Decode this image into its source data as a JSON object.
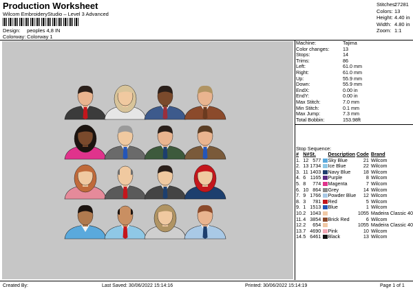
{
  "header": {
    "title": "Production Worksheet",
    "subtitle": "Wilcom EmbroideryStudio – Level 3 Advanced",
    "design_label": "Design:",
    "design_value": "peoples 4,8 IN",
    "colorway_label": "Colorway:",
    "colorway_value": "Colorway 1"
  },
  "summary": [
    {
      "label": "Stitches:",
      "value": "27281"
    },
    {
      "label": "Colors:",
      "value": "13"
    },
    {
      "label": "Height:",
      "value": "4.40 in"
    },
    {
      "label": "Width:",
      "value": "4.80 in"
    },
    {
      "label": "Zoom:",
      "value": "1:1"
    }
  ],
  "properties": [
    {
      "label": "Machine:",
      "value": "Tajima"
    },
    {
      "label": "Color changes:",
      "value": "13"
    },
    {
      "label": "Stops:",
      "value": "14"
    },
    {
      "label": "Trims:",
      "value": "86"
    },
    {
      "label": "Left:",
      "value": "61.0 mm"
    },
    {
      "label": "Right:",
      "value": "61.0 mm"
    },
    {
      "label": "Up:",
      "value": "55.9 mm"
    },
    {
      "label": "Down:",
      "value": "55.9 mm"
    },
    {
      "label": "EndX:",
      "value": "0.00 in"
    },
    {
      "label": "EndY:",
      "value": "0.00 in"
    },
    {
      "label": "Max Stitch:",
      "value": "7.0 mm"
    },
    {
      "label": "Min Stitch:",
      "value": "0.1 mm"
    },
    {
      "label": "Max Jump:",
      "value": "7.3 mm"
    },
    {
      "label": "Total Bobbin:",
      "value": "153.98ft"
    }
  ],
  "stop_sequence": {
    "title": "Stop Sequence:",
    "columns": [
      "#",
      "N#",
      "St.",
      "Description",
      "Code",
      "Brand"
    ],
    "rows": [
      {
        "n": "1.",
        "needle": "12",
        "st": "577",
        "color": "#5aa9dc",
        "desc": "Sky Blue",
        "code": "21",
        "brand": "Wilcom"
      },
      {
        "n": "2.",
        "needle": "13",
        "st": "1734",
        "color": "#8fc8e6",
        "desc": "Ice Blue",
        "code": "22",
        "brand": "Wilcom"
      },
      {
        "n": "3.",
        "needle": "11",
        "st": "1403",
        "color": "#1d3f6e",
        "desc": "Navy Blue",
        "code": "18",
        "brand": "Wilcom"
      },
      {
        "n": "4.",
        "needle": "6",
        "st": "1165",
        "color": "#5a2b82",
        "desc": "Purple",
        "code": "8",
        "brand": "Wilcom"
      },
      {
        "n": "5.",
        "needle": "8",
        "st": "774",
        "color": "#e0338c",
        "desc": "Magenta",
        "code": "7",
        "brand": "Wilcom"
      },
      {
        "n": "6.",
        "needle": "10",
        "st": "864",
        "color": "#8a8a8a",
        "desc": "Grey",
        "code": "14",
        "brand": "Wilcom"
      },
      {
        "n": "7.",
        "needle": "9",
        "st": "1766",
        "color": "#a9c9e6",
        "desc": "Powder Blue",
        "code": "12",
        "brand": "Wilcom"
      },
      {
        "n": "8.",
        "needle": "3",
        "st": "781",
        "color": "#c4161c",
        "desc": "Red",
        "code": "5",
        "brand": "Wilcom"
      },
      {
        "n": "9.",
        "needle": "1",
        "st": "1513",
        "color": "#2456b8",
        "desc": "Blue",
        "code": "1",
        "brand": "Wilcom"
      },
      {
        "n": "10.",
        "needle": "2",
        "st": "1043",
        "color": "#f1c9a5",
        "desc": "",
        "code": "1055",
        "brand": "Madeira Classic 40"
      },
      {
        "n": "11.",
        "needle": "4",
        "st": "3854",
        "color": "#8b4a2b",
        "desc": "Brick Red",
        "code": "6",
        "brand": "Wilcom"
      },
      {
        "n": "12.",
        "needle": "2",
        "st": "654",
        "color": "#f1c9a5",
        "desc": "",
        "code": "1055",
        "brand": "Madeira Classic 40"
      },
      {
        "n": "13.",
        "needle": "7",
        "st": "4690",
        "color": "#f3a7b5",
        "desc": "Pink",
        "code": "10",
        "brand": "Wilcom"
      },
      {
        "n": "14.",
        "needle": "5",
        "st": "6461",
        "color": "#111111",
        "desc": "Black",
        "code": "13",
        "brand": "Wilcom"
      }
    ]
  },
  "footer": {
    "created_by": "Created By:",
    "last_saved": "Last Saved: 30/06/2022 15:14:16",
    "printed": "Printed: 30/06/2022 15:14:19",
    "page": "Page 1 of 1"
  }
}
